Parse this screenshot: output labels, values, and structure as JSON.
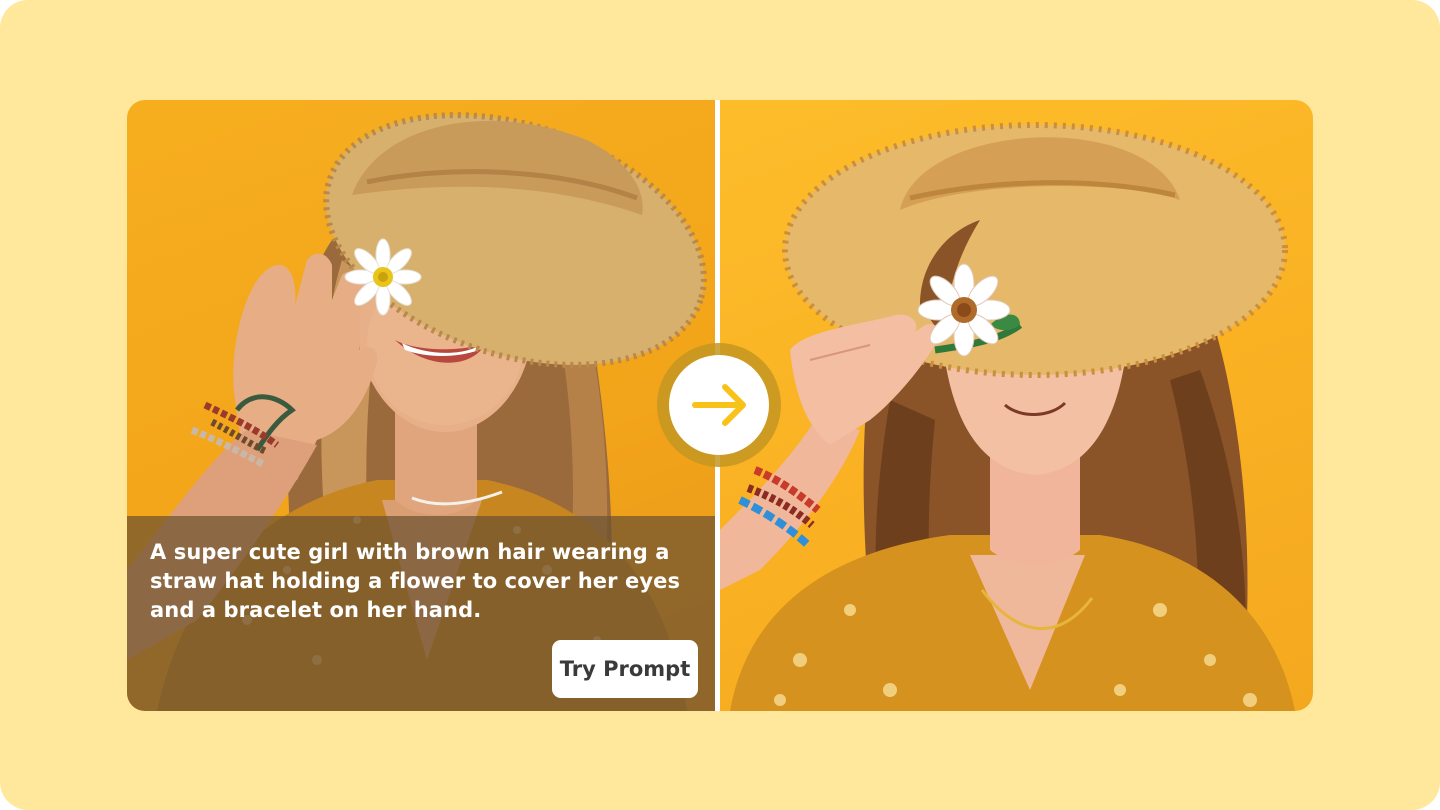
{
  "colors": {
    "page_background": "#ffe89c",
    "accent_yellow": "#f8c219",
    "caption_overlay": "#6e5230",
    "button_background": "#ffffff"
  },
  "comparison": {
    "original_photo": {
      "icon": "photo-woman-straw-hat"
    },
    "generated_image": {
      "icon": "anime-girl-straw-hat"
    },
    "transform_icon": "arrow-right-icon"
  },
  "prompt": {
    "text": "A super cute girl with brown hair wearing a straw hat holding a flower to cover her eyes and a bracelet on her hand.",
    "button_label": "Try Prompt"
  }
}
